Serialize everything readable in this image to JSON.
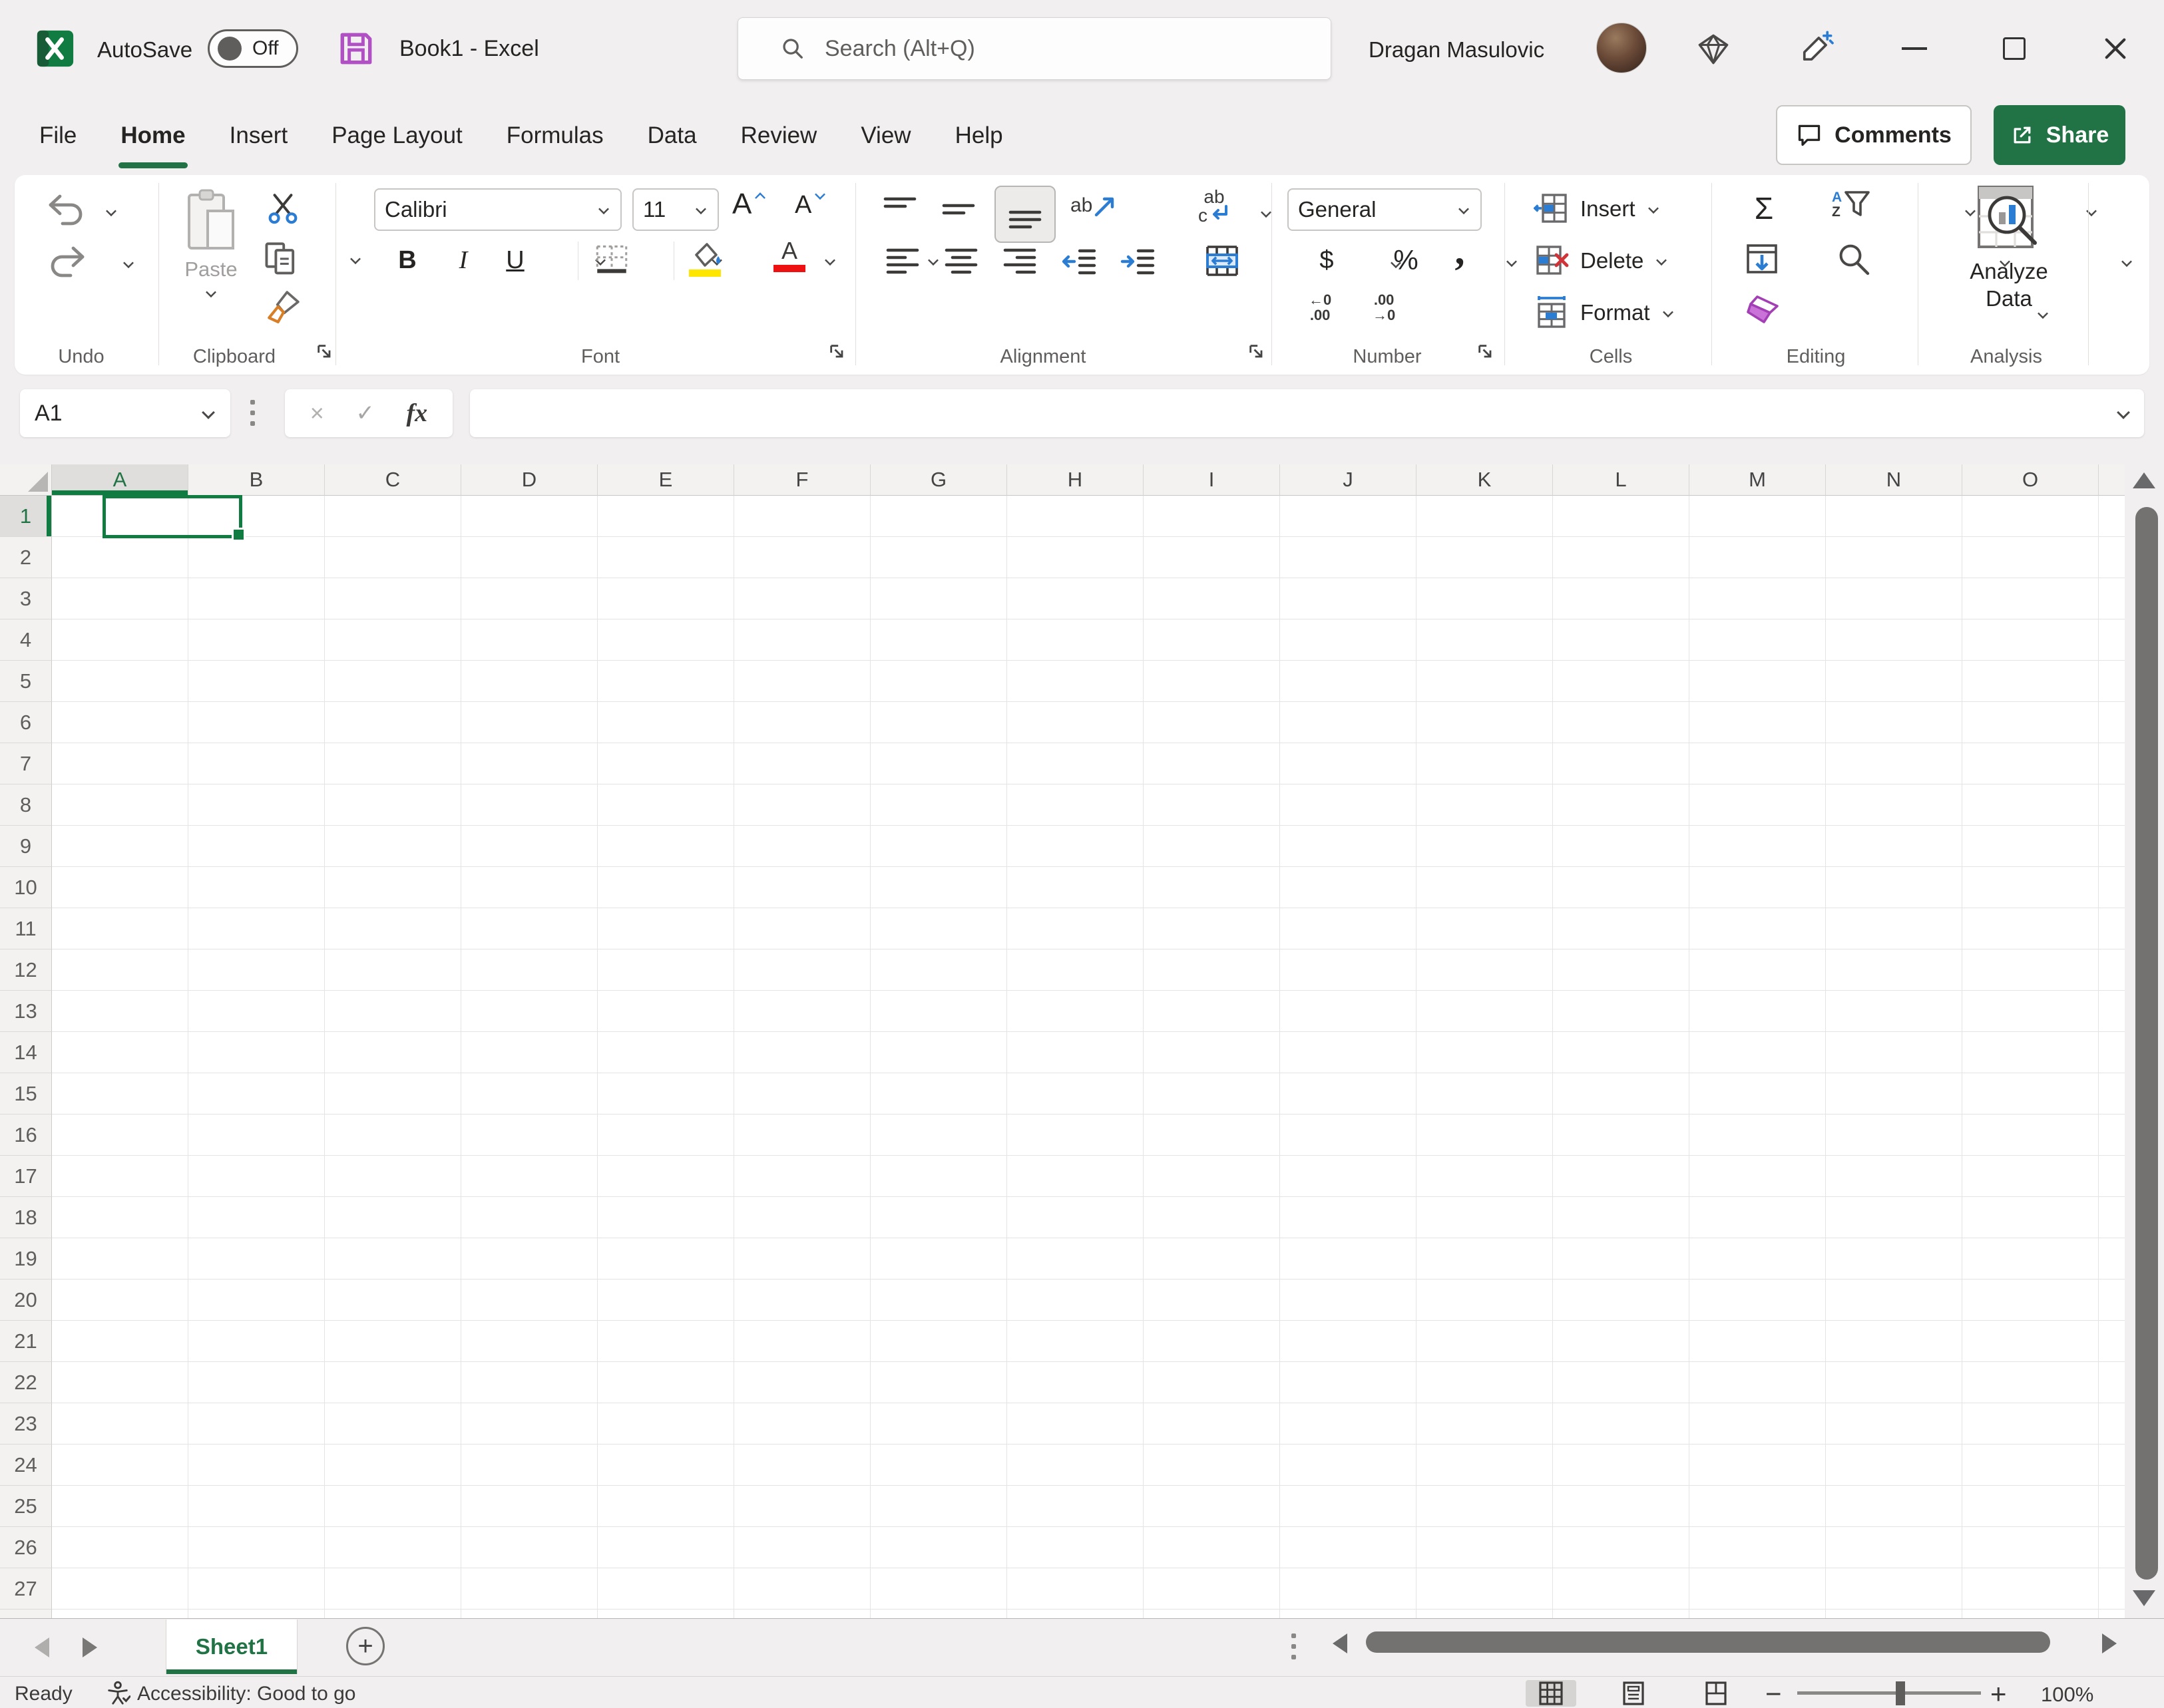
{
  "titlebar": {
    "autosave_label": "AutoSave",
    "autosave_state": "Off",
    "document_title": "Book1 - Excel",
    "search_placeholder": "Search (Alt+Q)",
    "user_name": "Dragan Masulovic"
  },
  "ribbon_tabs": {
    "items": [
      {
        "label": "File",
        "active": false
      },
      {
        "label": "Home",
        "active": true
      },
      {
        "label": "Insert",
        "active": false
      },
      {
        "label": "Page Layout",
        "active": false
      },
      {
        "label": "Formulas",
        "active": false
      },
      {
        "label": "Data",
        "active": false
      },
      {
        "label": "Review",
        "active": false
      },
      {
        "label": "View",
        "active": false
      },
      {
        "label": "Help",
        "active": false
      }
    ],
    "comments_label": "Comments",
    "share_label": "Share"
  },
  "ribbon": {
    "undo_group_label": "Undo",
    "clipboard_group_label": "Clipboard",
    "paste_label": "Paste",
    "font_group_label": "Font",
    "font_name": "Calibri",
    "font_size": "11",
    "alignment_group_label": "Alignment",
    "number_group_label": "Number",
    "number_format": "General",
    "cells_group_label": "Cells",
    "insert_label": "Insert",
    "delete_label": "Delete",
    "format_label": "Format",
    "editing_group_label": "Editing",
    "analysis_group_label": "Analysis",
    "analyze_data_label": "Analyze Data"
  },
  "glyphs": {
    "bold": "B",
    "italic": "I",
    "underline": "U",
    "grow_font": "A",
    "shrink_font": "A",
    "font_color": "A",
    "orientation_ab": "ab",
    "wrap_ab": "ab",
    "wrap_c": "c",
    "dollar": "$",
    "percent": "%",
    "comma": ",",
    "increase_decimal_top": "←0",
    "increase_decimal_bottom": ".00",
    "decrease_decimal_top": ".00",
    "decrease_decimal_bottom": "→0",
    "sum": "Σ",
    "sort_a": "A",
    "sort_z": "Z",
    "fx": "fx",
    "cancel": "×",
    "enter": "✓",
    "new_sheet": "+",
    "zoom_out": "−",
    "zoom_in": "+"
  },
  "formula_bar": {
    "cell_reference": "A1",
    "formula_value": ""
  },
  "grid": {
    "columns": [
      "A",
      "B",
      "C",
      "D",
      "E",
      "F",
      "G",
      "H",
      "I",
      "J",
      "K",
      "L",
      "M",
      "N",
      "O"
    ],
    "visible_rows": 27,
    "selected_cell": "A1",
    "selected_column": "A",
    "selected_row": 1
  },
  "sheet_bar": {
    "sheets": [
      {
        "name": "Sheet1",
        "active": true
      }
    ]
  },
  "status_bar": {
    "mode": "Ready",
    "accessibility_status": "Accessibility: Good to go",
    "zoom_level": "100%"
  },
  "colors": {
    "excel_green": "#217346",
    "selection_green": "#107c41",
    "accent_blue": "#2b7cd3",
    "highlight_yellow": "#ffe600",
    "font_color_red": "#ee1111",
    "save_icon_purple": "#b14fc5",
    "format_painter_orange": "#d87e27",
    "eraser_purple": "#a33fb5",
    "chrome": "#f1efef",
    "scrollbar_thumb": "#747270"
  }
}
